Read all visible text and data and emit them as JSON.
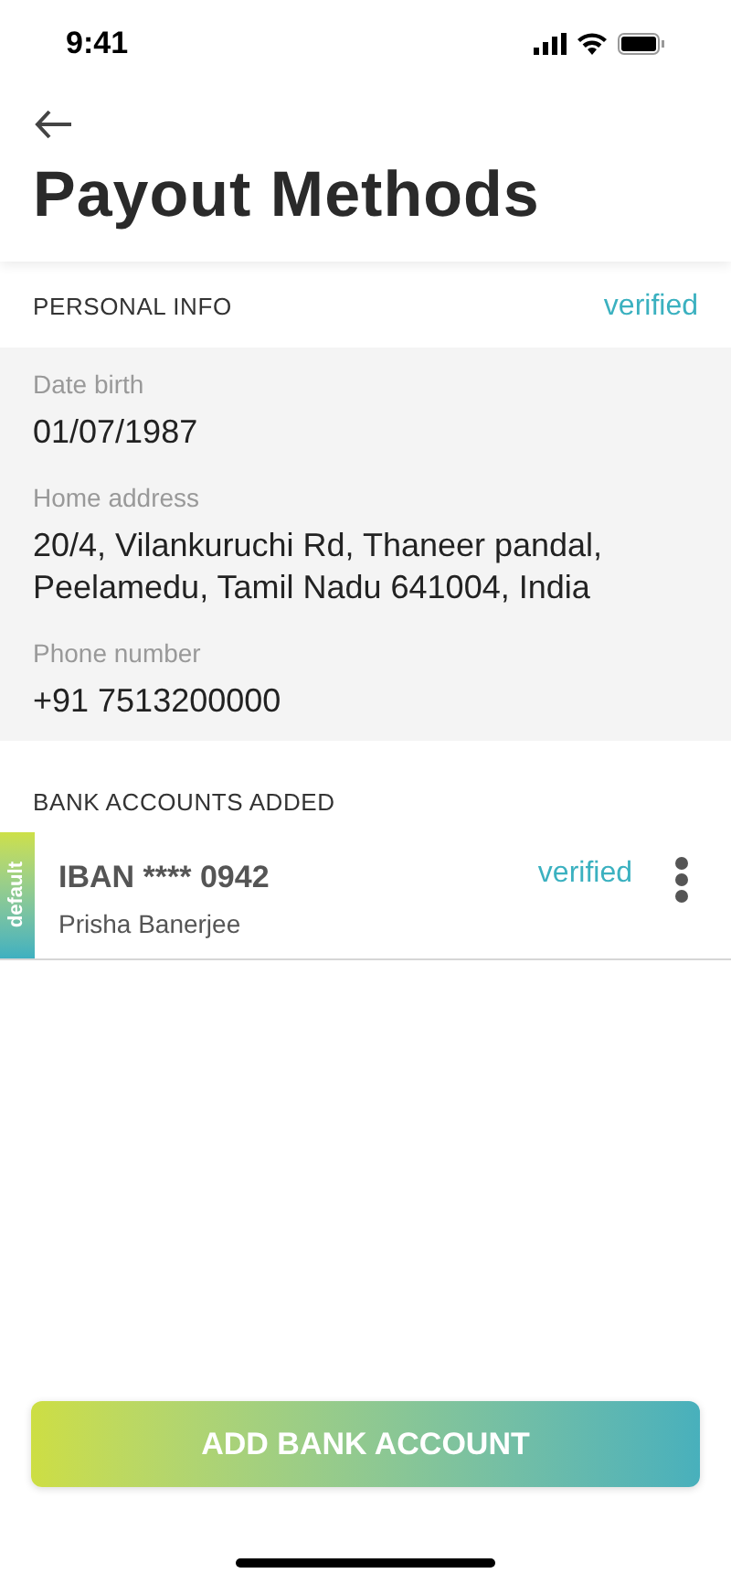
{
  "status_bar": {
    "time": "9:41"
  },
  "header": {
    "title": "Payout Methods"
  },
  "personal_info": {
    "heading": "PERSONAL INFO",
    "status": "verified",
    "fields": [
      {
        "label": "Date birth",
        "value": "01/07/1987"
      },
      {
        "label": "Home address",
        "value": "20/4, Vilankuruchi Rd, Thaneer pandal, Peelamedu, Tamil Nadu 641004, India"
      },
      {
        "label": "Phone number",
        "value": "+91 7513200000"
      }
    ]
  },
  "bank_accounts": {
    "heading": "BANK ACCOUNTS ADDED",
    "items": [
      {
        "tag": "default",
        "number": "IBAN **** 0942",
        "holder": "Prisha Banerjee",
        "status": "verified"
      }
    ]
  },
  "add_button": {
    "label": "ADD BANK ACCOUNT"
  }
}
